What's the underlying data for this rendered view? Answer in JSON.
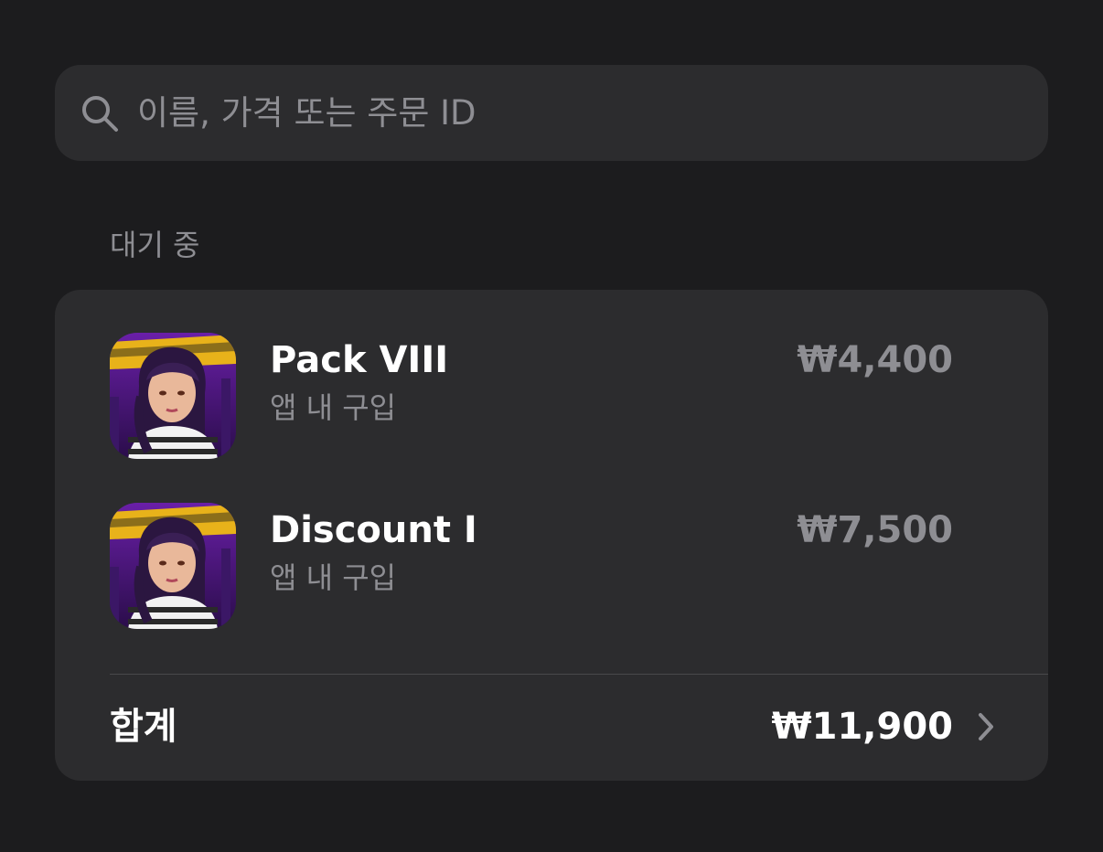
{
  "search": {
    "placeholder": "이름, 가격 또는 주문 ID",
    "icon": "search-icon"
  },
  "section": {
    "header": "대기 중"
  },
  "items": [
    {
      "name": "Pack VIII",
      "subtitle": "앱 내 구입",
      "price": "₩4,400",
      "icon": "game-app-icon"
    },
    {
      "name": "Discount I",
      "subtitle": "앱 내 구입",
      "price": "₩7,500",
      "icon": "game-app-icon"
    }
  ],
  "total": {
    "label": "합계",
    "value": "₩11,900",
    "icon": "chevron-right-icon"
  },
  "colors": {
    "background": "#1c1c1e",
    "card": "#2c2c2e",
    "primary_text": "#ffffff",
    "secondary_text": "#8e8e93"
  }
}
